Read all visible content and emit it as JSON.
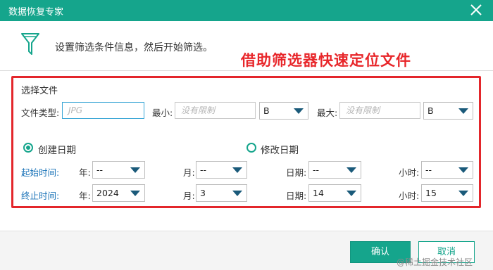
{
  "window": {
    "title": "数据恢复专家",
    "close_icon": "close-icon"
  },
  "header": {
    "description": "设置筛选条件信息，然后开始筛选。",
    "annotation": "借助筛选器快速定位文件",
    "icon": "funnel-icon"
  },
  "colors": {
    "accent": "#15a58c",
    "annotation": "#e8262a",
    "link_blue": "#1a73b8"
  },
  "file_section": {
    "title": "选择文件",
    "type_label": "文件类型:",
    "type_placeholder": "JPG",
    "min_label": "最小:",
    "min_placeholder": "没有限制",
    "min_unit": "B",
    "max_label": "最大:",
    "max_placeholder": "没有限制",
    "max_unit": "B"
  },
  "date_mode": {
    "created_label": "创建日期",
    "created_checked": true,
    "modified_label": "修改日期",
    "modified_checked": false
  },
  "start_time": {
    "label": "起始时间:",
    "year_label": "年:",
    "year_value": "--",
    "month_label": "月:",
    "month_value": "--",
    "day_label": "日期:",
    "day_value": "--",
    "hour_label": "小时:",
    "hour_value": "--"
  },
  "end_time": {
    "label": "终止时间:",
    "year_label": "年:",
    "year_value": "2024",
    "month_label": "月:",
    "month_value": "3",
    "day_label": "日期:",
    "day_value": "14",
    "hour_label": "小时:",
    "hour_value": "15"
  },
  "footer": {
    "ok_label": "确认",
    "cancel_label": "取消"
  },
  "watermark": "@稀土掘金技术社区"
}
